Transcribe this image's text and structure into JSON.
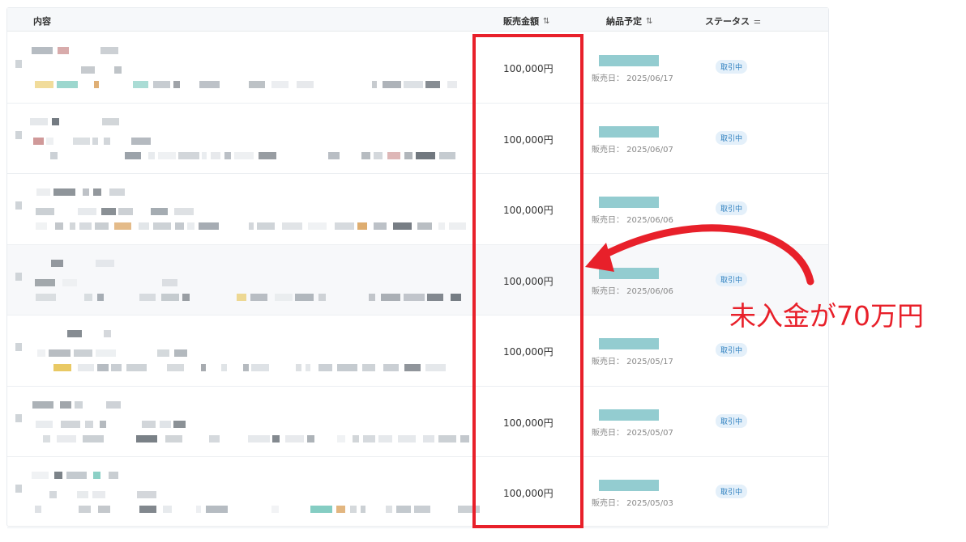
{
  "header": {
    "content": "内容",
    "amount": "販売金額",
    "delivery": "納品予定",
    "status": "ステータス"
  },
  "rows": [
    {
      "amount": "100,000円",
      "sold_date": "販売日： 2025/06/17",
      "status": "取引中"
    },
    {
      "amount": "100,000円",
      "sold_date": "販売日： 2025/06/07",
      "status": "取引中"
    },
    {
      "amount": "100,000円",
      "sold_date": "販売日： 2025/06/06",
      "status": "取引中"
    },
    {
      "amount": "100,000円",
      "sold_date": "販売日： 2025/06/06",
      "status": "取引中"
    },
    {
      "amount": "100,000円",
      "sold_date": "販売日： 2025/05/17",
      "status": "取引中"
    },
    {
      "amount": "100,000円",
      "sold_date": "販売日： 2025/05/07",
      "status": "取引中"
    },
    {
      "amount": "100,000円",
      "sold_date": "販売日： 2025/05/03",
      "status": "取引中"
    }
  ],
  "annotation": {
    "text": "未入金が70万円",
    "color": "#e8202a"
  },
  "icons": {
    "sort": "sort-icon",
    "filter": "filter-icon"
  },
  "colors": {
    "delivery_bar": "#93ccd0",
    "badge_text": "#2d7fbf",
    "badge_bg": "#e4f0fa",
    "highlight": "#e8202a"
  }
}
